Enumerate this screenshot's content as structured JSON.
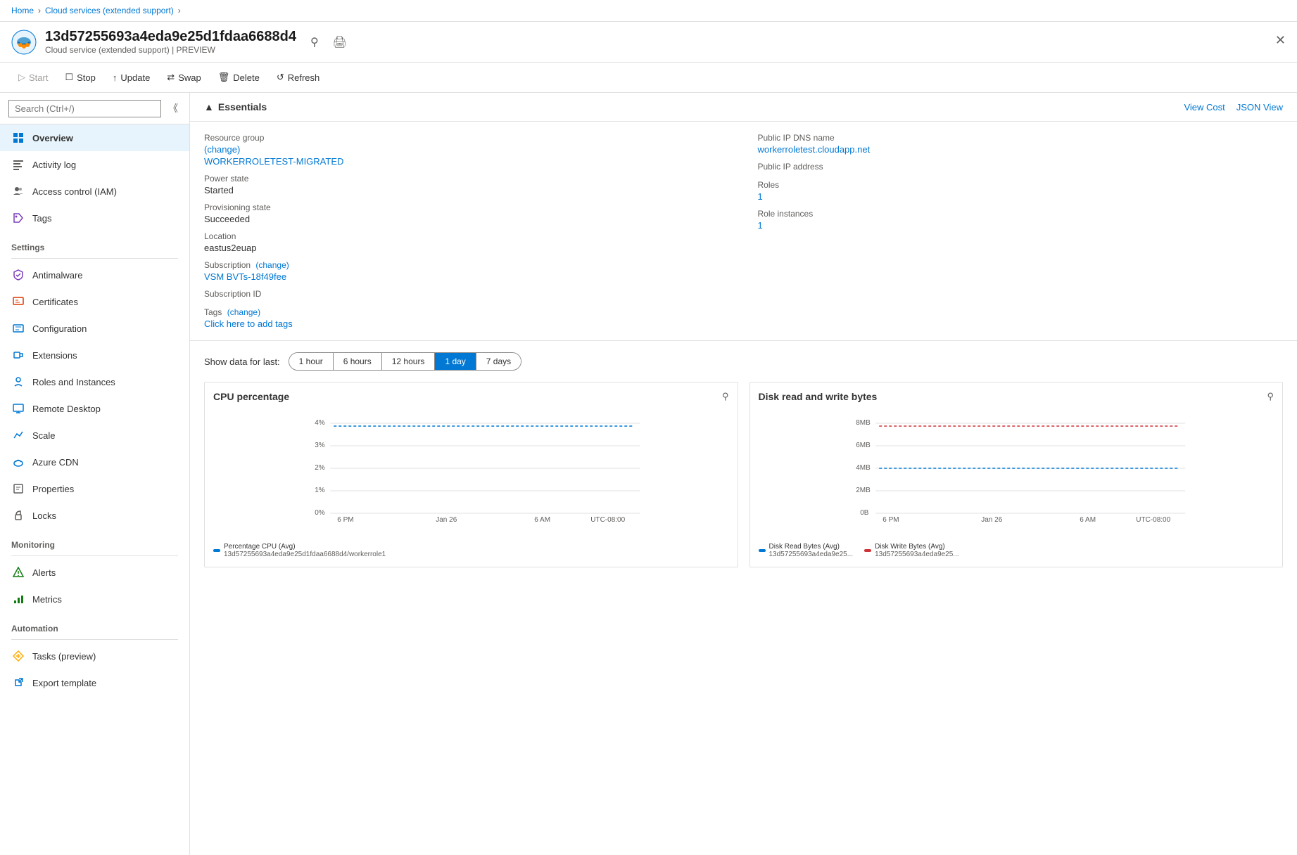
{
  "breadcrumb": {
    "home": "Home",
    "service": "Cloud services (extended support)"
  },
  "header": {
    "title": "13d57255693a4eda9e25d1fdaa6688d4",
    "subtitle": "Cloud service (extended support) | PREVIEW"
  },
  "toolbar": {
    "start_label": "Start",
    "stop_label": "Stop",
    "update_label": "Update",
    "swap_label": "Swap",
    "delete_label": "Delete",
    "refresh_label": "Refresh"
  },
  "sidebar": {
    "search_placeholder": "Search (Ctrl+/)",
    "nav_items": [
      {
        "id": "overview",
        "label": "Overview",
        "icon": "⬡",
        "active": true
      },
      {
        "id": "activity-log",
        "label": "Activity log",
        "icon": "≡"
      },
      {
        "id": "access-control",
        "label": "Access control (IAM)",
        "icon": "👥"
      },
      {
        "id": "tags",
        "label": "Tags",
        "icon": "🏷"
      }
    ],
    "settings_label": "Settings",
    "settings_items": [
      {
        "id": "antimalware",
        "label": "Antimalware",
        "icon": "🛡"
      },
      {
        "id": "certificates",
        "label": "Certificates",
        "icon": "📋"
      },
      {
        "id": "configuration",
        "label": "Configuration",
        "icon": "⚙"
      },
      {
        "id": "extensions",
        "label": "Extensions",
        "icon": "🔌"
      },
      {
        "id": "roles-instances",
        "label": "Roles and Instances",
        "icon": "⚙"
      },
      {
        "id": "remote-desktop",
        "label": "Remote Desktop",
        "icon": "🖥"
      },
      {
        "id": "scale",
        "label": "Scale",
        "icon": "📈"
      },
      {
        "id": "azure-cdn",
        "label": "Azure CDN",
        "icon": "☁"
      },
      {
        "id": "properties",
        "label": "Properties",
        "icon": "📄"
      },
      {
        "id": "locks",
        "label": "Locks",
        "icon": "🔒"
      }
    ],
    "monitoring_label": "Monitoring",
    "monitoring_items": [
      {
        "id": "alerts",
        "label": "Alerts",
        "icon": "🔔"
      },
      {
        "id": "metrics",
        "label": "Metrics",
        "icon": "📊"
      }
    ],
    "automation_label": "Automation",
    "automation_items": [
      {
        "id": "tasks",
        "label": "Tasks (preview)",
        "icon": "⚡"
      },
      {
        "id": "export",
        "label": "Export template",
        "icon": "📤"
      }
    ]
  },
  "essentials": {
    "title": "Essentials",
    "view_cost": "View Cost",
    "json_view": "JSON View",
    "resource_group_label": "Resource group",
    "resource_group_change": "(change)",
    "resource_group_value": "WORKERROLETEST-MIGRATED",
    "power_state_label": "Power state",
    "power_state_value": "Started",
    "provisioning_label": "Provisioning state",
    "provisioning_value": "Succeeded",
    "location_label": "Location",
    "location_value": "eastus2euap",
    "subscription_label": "Subscription",
    "subscription_change": "(change)",
    "subscription_value": "VSM BVTs-18f49fee",
    "subscription_id_label": "Subscription ID",
    "subscription_id_value": "",
    "tags_label": "Tags",
    "tags_change": "(change)",
    "tags_value": "Click here to add tags",
    "public_ip_dns_label": "Public IP DNS name",
    "public_ip_dns_value": "workerroletest.cloudapp.net",
    "public_ip_label": "Public IP address",
    "public_ip_value": "",
    "roles_label": "Roles",
    "roles_value": "1",
    "role_instances_label": "Role instances",
    "role_instances_value": "1"
  },
  "time_filter": {
    "label": "Show data for last:",
    "options": [
      "1 hour",
      "6 hours",
      "12 hours",
      "1 day",
      "7 days"
    ],
    "active": "1 day"
  },
  "charts": {
    "cpu": {
      "title": "CPU percentage",
      "y_labels": [
        "4%",
        "3%",
        "2%",
        "1%",
        "0%"
      ],
      "x_labels": [
        "6 PM",
        "Jan 26",
        "6 AM",
        "UTC-08:00"
      ],
      "legend": [
        {
          "label": "Percentage CPU (Avg)",
          "sublabel": "13d57255693a4eda9e25d1fdaa6688d4/workerrole1",
          "color": "#0078d4"
        }
      ]
    },
    "disk": {
      "title": "Disk read and write bytes",
      "y_labels": [
        "8MB",
        "6MB",
        "4MB",
        "2MB",
        "0B"
      ],
      "x_labels": [
        "6 PM",
        "Jan 26",
        "6 AM",
        "UTC-08:00"
      ],
      "legend": [
        {
          "label": "Disk Read Bytes (Avg)",
          "sublabel": "13d57255693a4eda9e25...",
          "color": "#0078d4"
        },
        {
          "label": "Disk Write Bytes (Avg)",
          "sublabel": "13d57255693a4eda9e25...",
          "color": "#d13438"
        }
      ]
    }
  }
}
